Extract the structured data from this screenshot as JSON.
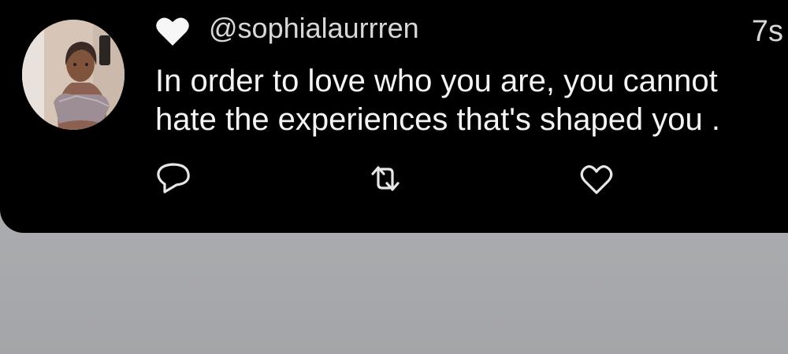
{
  "post": {
    "handle": "@sophialaurrren",
    "timestamp": "7s",
    "text": "In order to love who you are, you cannot hate the experiences that's shaped you ."
  },
  "icons": {
    "badge": "heart-icon",
    "reply": "reply-icon",
    "retweet": "retweet-icon",
    "like": "like-icon"
  },
  "colors": {
    "card_background": "#000000",
    "text": "#f4f4f4",
    "secondary_text": "#d8d8d8",
    "page_background": "#a7a8ab"
  }
}
